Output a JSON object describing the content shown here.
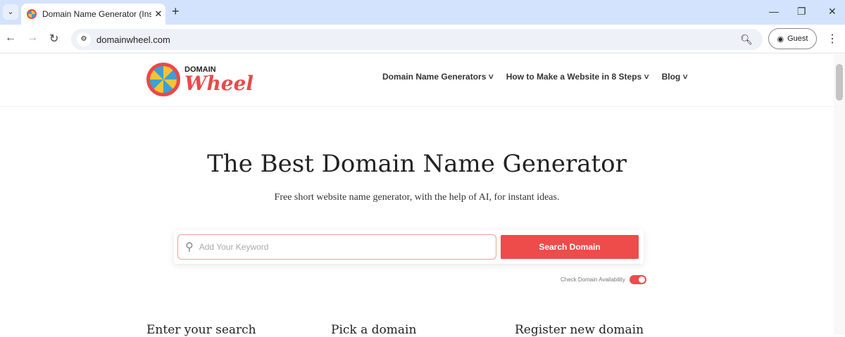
{
  "browser": {
    "tab_title": "Domain Name Generator (Insta",
    "url": "domainwheel.com",
    "profile": "Guest"
  },
  "site": {
    "logo_top": "DOMAIN",
    "logo_bottom": "Wheel",
    "nav": [
      "Domain Name Generators",
      "How to Make a Website in 8 Steps",
      "Blog"
    ],
    "title": "The Best Domain Name Generator",
    "subtitle": "Free short website name generator, with the help of AI, for instant ideas.",
    "search_placeholder": "Add Your Keyword",
    "search_button": "Search Domain",
    "availability_label": "Check Domain Availability",
    "availability_on": true,
    "steps": [
      "Enter your search",
      "Pick a domain",
      "Register new domain"
    ]
  }
}
